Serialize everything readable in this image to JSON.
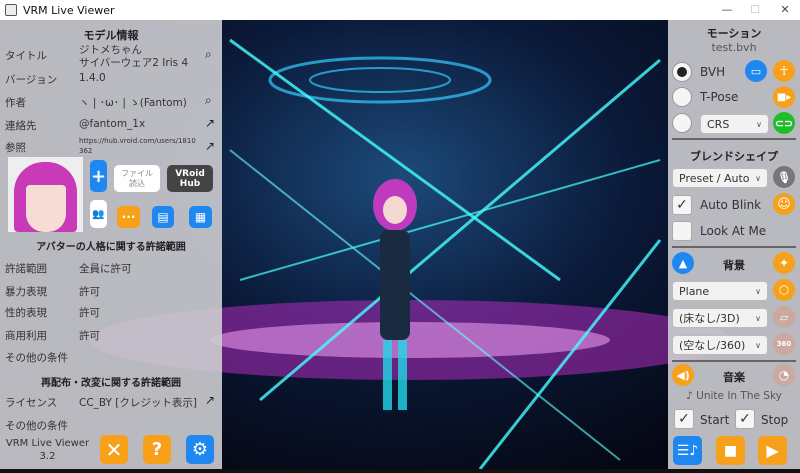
{
  "window": {
    "title": "VRM Live Viewer",
    "minimize": "—",
    "maximize": "☐",
    "close": "✕"
  },
  "left": {
    "model_header": "モデル情報",
    "rows": [
      {
        "label": "タイトル",
        "value1": "ジトメちゃん",
        "value2": "サイバーウェア2 Iris 4"
      },
      {
        "label": "バージョン",
        "value": "1.4.0"
      },
      {
        "label": "作者",
        "value": "ヽ | ･ω･ | ゝ(Fantom)"
      },
      {
        "label": "連絡先",
        "value": "@fantom_1x"
      },
      {
        "label": "参照",
        "value": "https://hub.vroid.com/users/1810362"
      }
    ],
    "file_load": "ファイル読込",
    "vroid_hub": "VRoid Hub",
    "avatar_header": "アバターの人格に関する許諾範囲",
    "avatar_rows": [
      {
        "label": "許諾範囲",
        "value": "全員に許可"
      },
      {
        "label": "暴力表現",
        "value": "許可"
      },
      {
        "label": "性的表現",
        "value": "許可"
      },
      {
        "label": "商用利用",
        "value": "許可"
      },
      {
        "label": "その他の条件",
        "value": ""
      }
    ],
    "redist_header": "再配布・改変に関する許諾範囲",
    "license_label": "ライセンス",
    "license_value": "CC_BY [クレジット表示]",
    "other_label": "その他の条件",
    "app_name": "VRM Live Viewer",
    "app_version": "3.2"
  },
  "right": {
    "motion_header": "モーション",
    "motion_file": "test.bvh",
    "bvh": "BVH",
    "tpose": "T-Pose",
    "crs": "CRS",
    "blend_header": "ブレンドシェイプ",
    "blend_select": "Preset / Auto",
    "auto_blink": "Auto Blink",
    "look_at_me": "Look At Me",
    "bg_header": "背景",
    "bg_select1": "Plane",
    "bg_select2": "(床なし/3D)",
    "bg_select3": "(空なし/360)",
    "badge360": "360",
    "music_header": "音楽",
    "track": "♪ Unite In The Sky",
    "start": "Start",
    "stop": "Stop"
  },
  "colors": {
    "blue": "#1e88f0",
    "orange": "#f7a01a",
    "green": "#1fbf2a"
  }
}
